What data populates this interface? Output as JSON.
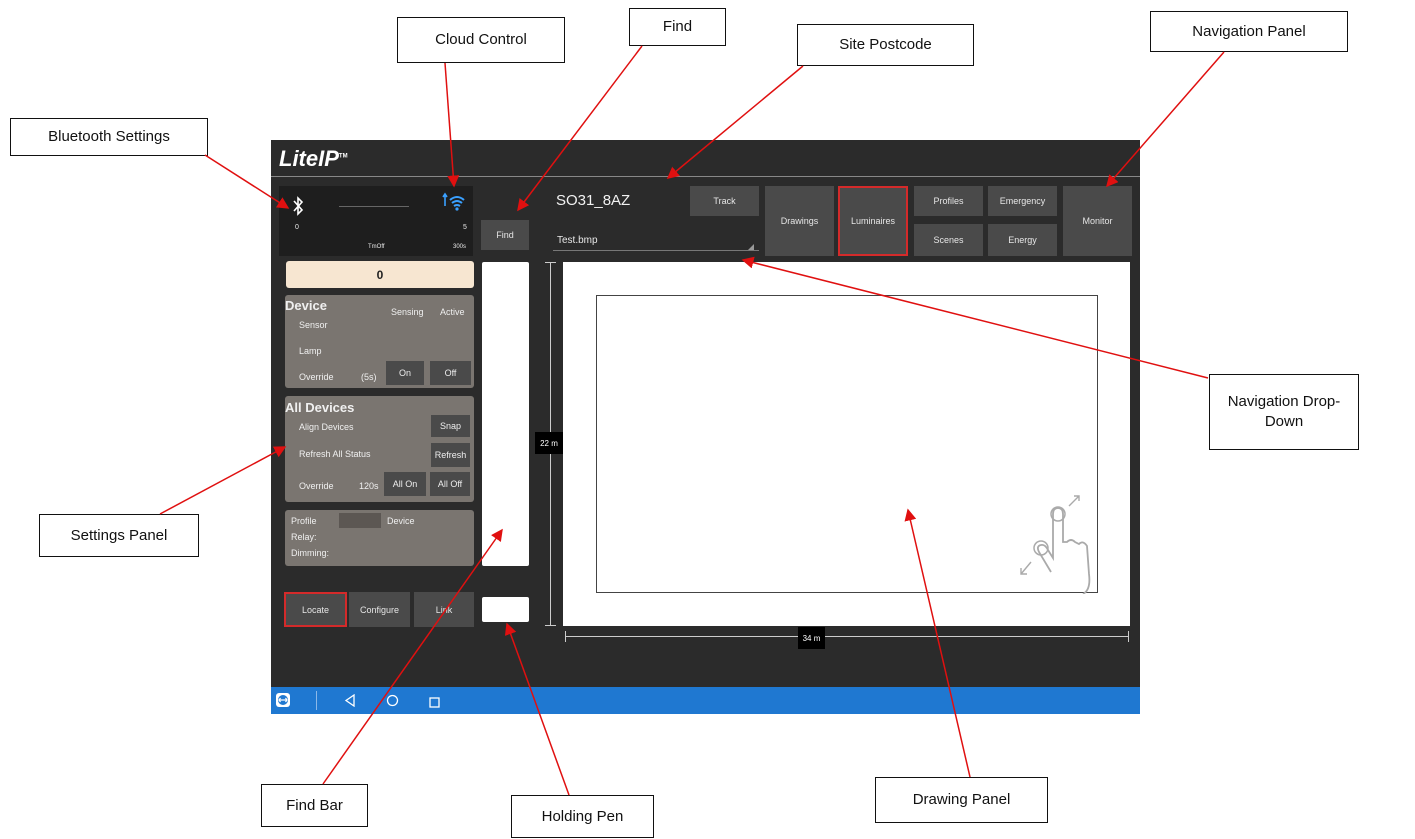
{
  "callouts": {
    "bluetooth_settings": "Bluetooth Settings",
    "cloud_control": "Cloud Control",
    "find": "Find",
    "site_postcode": "Site Postcode",
    "navigation_panel": "Navigation Panel",
    "navigation_dropdown_line1": "Navigation Drop-",
    "navigation_dropdown_line2": "Down",
    "settings_panel": "Settings Panel",
    "find_bar": "Find Bar",
    "holding_pen": "Holding Pen",
    "drawing_panel": "Drawing Panel"
  },
  "app": {
    "logo": "LiteIP",
    "logo_tm": "TM",
    "status": {
      "bt_count": "0",
      "cloud_count": "5",
      "tm_label": "TmOff",
      "cloud_time": "300s"
    },
    "find_button": "Find",
    "site_postcode": "SO31_8AZ",
    "drawing_file": "Test.bmp",
    "nav": {
      "track": "Track",
      "drawings": "Drawings",
      "luminaires": "Luminaires",
      "profiles": "Profiles",
      "emergency": "Emergency",
      "scenes": "Scenes",
      "energy": "Energy",
      "monitor": "Monitor"
    },
    "counter": "0",
    "device": {
      "title": "Device",
      "sensing": "Sensing",
      "active": "Active",
      "sensor": "Sensor",
      "lamp": "Lamp",
      "override": "Override",
      "duration": "(5s)",
      "on": "On",
      "off": "Off"
    },
    "all_devices": {
      "title": "All Devices",
      "align": "Align Devices",
      "snap": "Snap",
      "refresh_status": "Refresh All Status",
      "refresh": "Refresh",
      "override": "Override",
      "duration": "120s",
      "all_on": "All On",
      "all_off": "All Off"
    },
    "info": {
      "profile": "Profile",
      "device": "Device",
      "relay": "Relay:",
      "dimming": "Dimming:"
    },
    "bottom_buttons": {
      "locate": "Locate",
      "configure": "Configure",
      "link": "Link"
    },
    "dimensions": {
      "height": "22 m",
      "width": "34 m"
    }
  }
}
